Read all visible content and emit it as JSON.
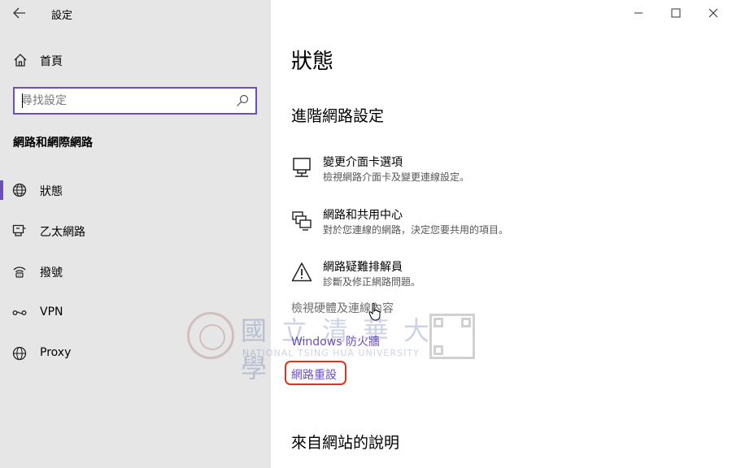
{
  "window": {
    "title": "設定",
    "controls": [
      "minimize",
      "maximize",
      "close"
    ]
  },
  "sidebar": {
    "home_label": "首頁",
    "search": {
      "placeholder": "尋找設定",
      "value": ""
    },
    "section_heading": "網路和網際網路",
    "items": [
      {
        "label": "狀態",
        "icon": "globe-icon",
        "selected": true
      },
      {
        "label": "乙太網路",
        "icon": "ethernet-icon",
        "selected": false
      },
      {
        "label": "撥號",
        "icon": "dialup-icon",
        "selected": false
      },
      {
        "label": "VPN",
        "icon": "vpn-icon",
        "selected": false
      },
      {
        "label": "Proxy",
        "icon": "globe-icon",
        "selected": false
      }
    ]
  },
  "main": {
    "page_title": "狀態",
    "advanced_heading": "進階網路設定",
    "options": [
      {
        "title": "變更介面卡選項",
        "desc": "檢視網路介面卡及變更連線設定。",
        "icon": "network-adapter-icon"
      },
      {
        "title": "網路和共用中心",
        "desc": "對於您連線的網路，決定您要共用的項目。",
        "icon": "sharing-center-icon"
      },
      {
        "title": "網路疑難排解員",
        "desc": "診斷及修正網路問題。",
        "icon": "warning-icon"
      }
    ],
    "hardware_link": "檢視硬體及連線內容",
    "firewall_link": "Windows 防火牆",
    "reset_link": "網路重設",
    "help_heading": "來自網站的說明"
  },
  "watermark": {
    "chinese": "國立清華大學",
    "english": "NATIONAL TSING HUA UNIVERSITY"
  },
  "colors": {
    "accent": "#6b4fbb",
    "sidebar_bg": "#e6e6e6",
    "highlight_box": "#e0301e"
  }
}
